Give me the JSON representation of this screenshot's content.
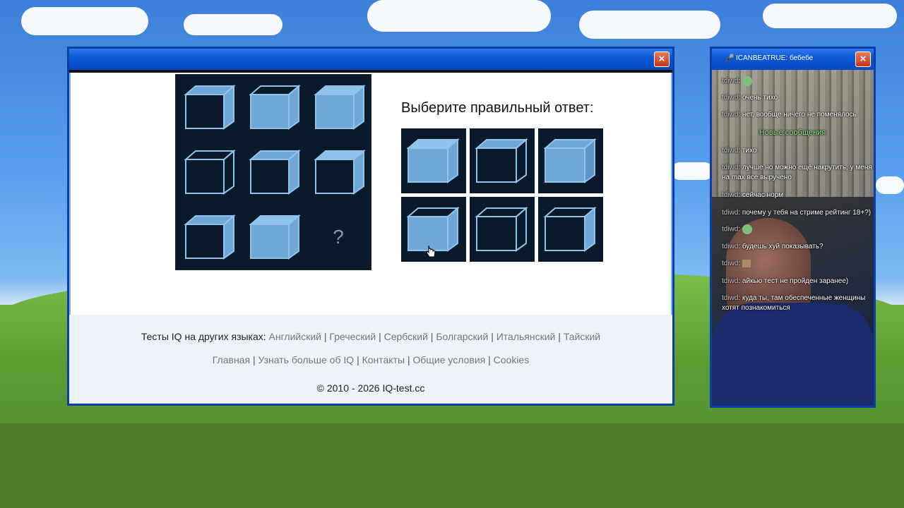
{
  "window": {
    "close_label": "×"
  },
  "puzzle": {
    "question_mark": "?"
  },
  "prompt": "Выберите правильный ответ:",
  "footer": {
    "languages_label": "Тесты IQ на других языках:",
    "languages": [
      "Английский",
      "Греческий",
      "Сербский",
      "Болгарский",
      "Итальянский",
      "Тайский"
    ],
    "nav": [
      "Главная",
      "Узнать больше об IQ",
      "Контакты",
      "Общие условия",
      "Cookies"
    ],
    "separator": "|",
    "copyright": "© 2010 - 2026 IQ-test.cc"
  },
  "chat": {
    "title": "ICANBEATRUE: бебебе",
    "close_label": "×",
    "new_messages": "Новые сообщения",
    "messages": [
      {
        "nick": "tdiwd",
        "text": ""
      },
      {
        "nick": "tdiwd",
        "text": "очень тихо"
      },
      {
        "nick": "tdiwd",
        "text": "нет, вообще ничего не поменялось"
      },
      {
        "nick": "tdiwd",
        "text": "тихо"
      },
      {
        "nick": "tdiwd",
        "text": "лучше но можно ещё накрутить, у меня на max все выручено"
      },
      {
        "nick": "tdiwd",
        "text": "сейчас норм"
      },
      {
        "nick": "tdiwd",
        "text": "почему у тебя на стриме рейтинг 18+?)"
      },
      {
        "nick": "tdiwd",
        "text": ""
      },
      {
        "nick": "tdiwd",
        "text": "будешь хуй показывать?"
      },
      {
        "nick": "tdiwd",
        "text": ""
      },
      {
        "nick": "tdiwd",
        "text": "айкью тест не пройден заранее)"
      },
      {
        "nick": "tdiwd",
        "text": "куда ты, там обеспеченные женщины хотят познакомиться"
      }
    ]
  },
  "colors": {
    "titlebar": "#0d58d6",
    "cube_fill": "#6fa8d6",
    "cube_edge": "#8fc3ea",
    "panel_bg": "#0a1a2b"
  }
}
